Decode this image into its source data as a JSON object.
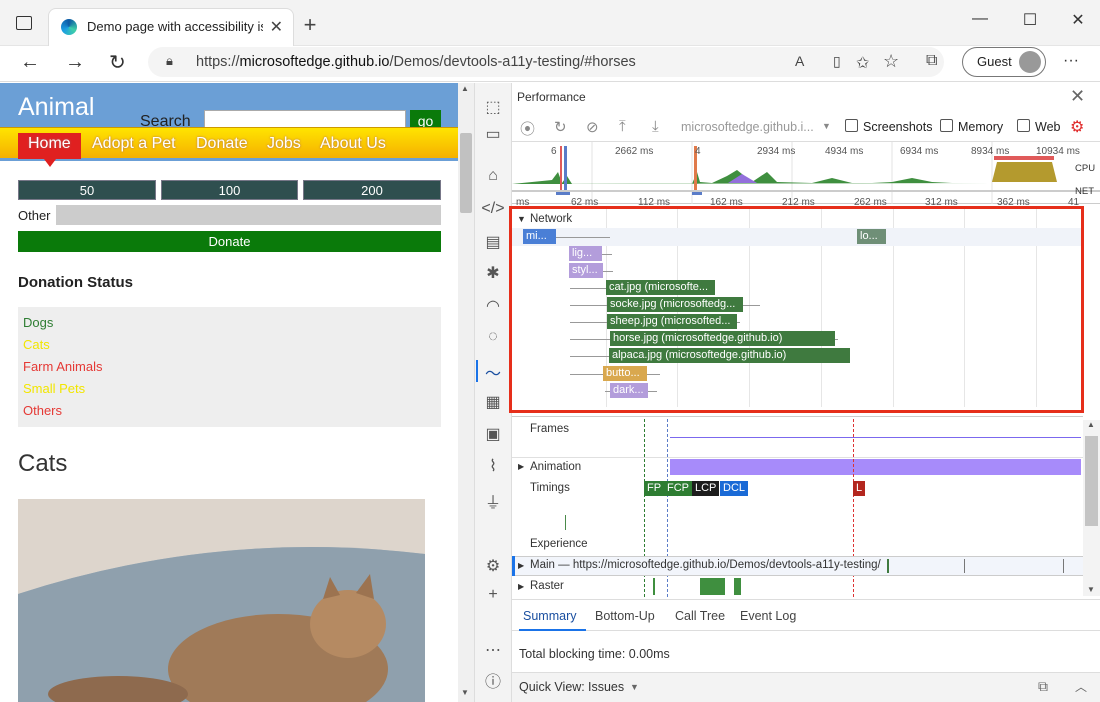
{
  "browser": {
    "tab_title": "Demo page with accessibility issu",
    "url_prefix": "https://",
    "url_host": "microsoftedge.github.io",
    "url_path": "/Demos/devtools-a11y-testing/#horses",
    "profile_label": "Guest"
  },
  "page": {
    "site_title": "Animal",
    "search_label": "Search",
    "search_button": "go",
    "nav": [
      "Home",
      "Adopt a Pet",
      "Donate",
      "Jobs",
      "About Us"
    ],
    "amounts": [
      "50",
      "100",
      "200"
    ],
    "other_label": "Other",
    "donate_button": "Donate",
    "donation_status_heading": "Donation Status",
    "statuses": [
      {
        "label": "Dogs",
        "color": "#2e7d32"
      },
      {
        "label": "Cats",
        "color": "#f2e600"
      },
      {
        "label": "Farm Animals",
        "color": "#e53935"
      },
      {
        "label": "Small Pets",
        "color": "#f2e600"
      },
      {
        "label": "Others",
        "color": "#e53935"
      }
    ],
    "cats_heading": "Cats"
  },
  "devtools": {
    "panel_title": "Performance",
    "profile_select": "microsoftedge.github.i...",
    "checkboxes": [
      "Screenshots",
      "Memory",
      "Web"
    ],
    "overview_ticks": [
      "6",
      "2662 ms",
      "4",
      "2934 ms",
      "4934 ms",
      "6934 ms",
      "8934 ms",
      "10934 ms"
    ],
    "cpu_label": "CPU",
    "net_label": "NET",
    "timeline_ticks": [
      "ms",
      "62 ms",
      "112 ms",
      "162 ms",
      "212 ms",
      "262 ms",
      "312 ms",
      "362 ms",
      "41"
    ],
    "network_label": "Network",
    "requests": [
      "mi...",
      "lo...",
      "lig...",
      "styl...",
      "cat.jpg (microsofte...",
      "socke.jpg (microsoftedg...",
      "sheep.jpg (microsofted...",
      "horse.jpg (microsoftedge.github.io)",
      "alpaca.jpg (microsoftedge.github.io)",
      "butto...",
      "dark..."
    ],
    "tracks": {
      "frames": "Frames",
      "animation": "Animation",
      "timings": "Timings",
      "experience": "Experience",
      "main": "Main — https://microsoftedge.github.io/Demos/devtools-a11y-testing/",
      "raster": "Raster"
    },
    "timing_markers": [
      "FP",
      "FCP",
      "LCP",
      "DCL",
      "L"
    ],
    "bottom_tabs": [
      "Summary",
      "Bottom-Up",
      "Call Tree",
      "Event Log"
    ],
    "total_blocking": "Total blocking time: 0.00ms",
    "quick_view_label": "Quick View:",
    "quick_view_value": "Issues"
  },
  "colors": {
    "accent": "#1a73e8",
    "highlight": "#e62e1a",
    "header_blue": "#6b9fd6",
    "donate_green": "#0a7a0a"
  }
}
